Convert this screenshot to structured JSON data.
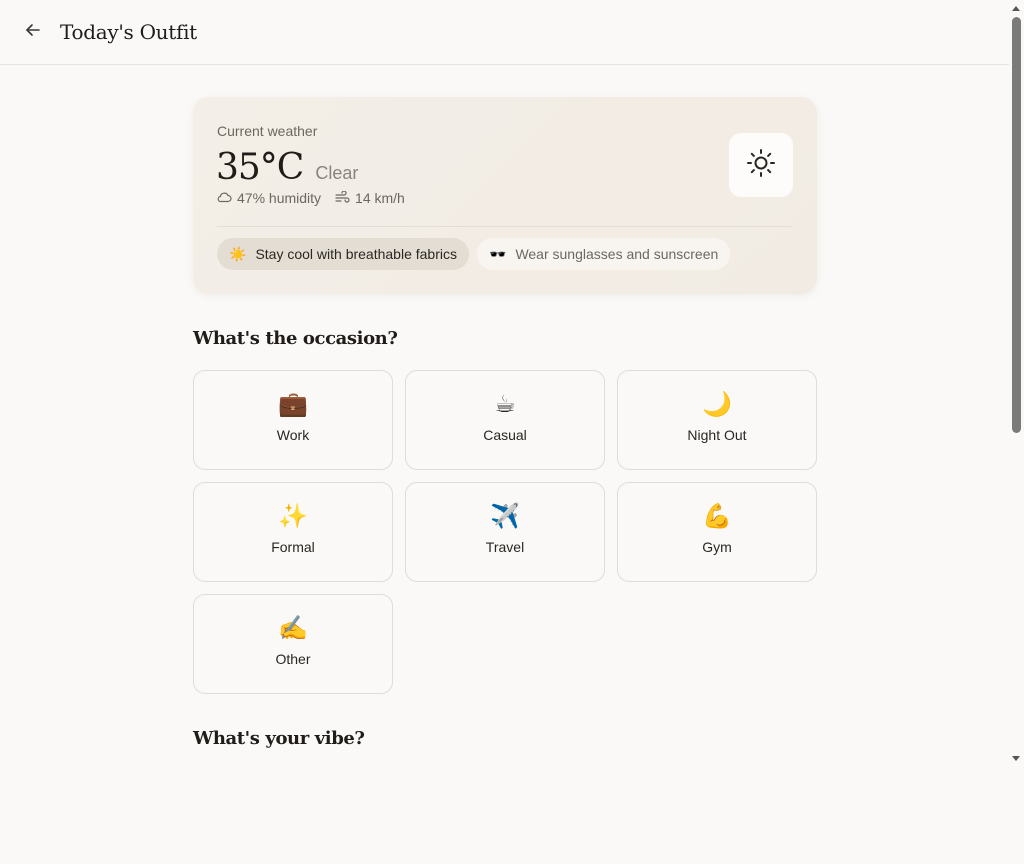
{
  "header": {
    "title": "Today's Outfit",
    "back_icon": "arrow-left-icon"
  },
  "weather": {
    "caption": "Current weather",
    "temperature": "35°C",
    "condition": "Clear",
    "humidity": "47% humidity",
    "wind": "14 km/h",
    "condition_icon": "sun-icon",
    "tips": [
      {
        "emoji": "☀️",
        "text": "Stay cool with breathable fabrics"
      },
      {
        "emoji": "🕶️",
        "text": "Wear sunglasses and sunscreen"
      }
    ]
  },
  "occasion": {
    "title": "What's the occasion?",
    "items": [
      {
        "emoji": "💼",
        "label": "Work"
      },
      {
        "emoji": "☕",
        "label": "Casual"
      },
      {
        "emoji": "🌙",
        "label": "Night Out"
      },
      {
        "emoji": "✨",
        "label": "Formal"
      },
      {
        "emoji": "✈️",
        "label": "Travel"
      },
      {
        "emoji": "💪",
        "label": "Gym"
      },
      {
        "emoji": "✍️",
        "label": "Other"
      }
    ]
  },
  "vibe": {
    "title": "What's your vibe?"
  }
}
